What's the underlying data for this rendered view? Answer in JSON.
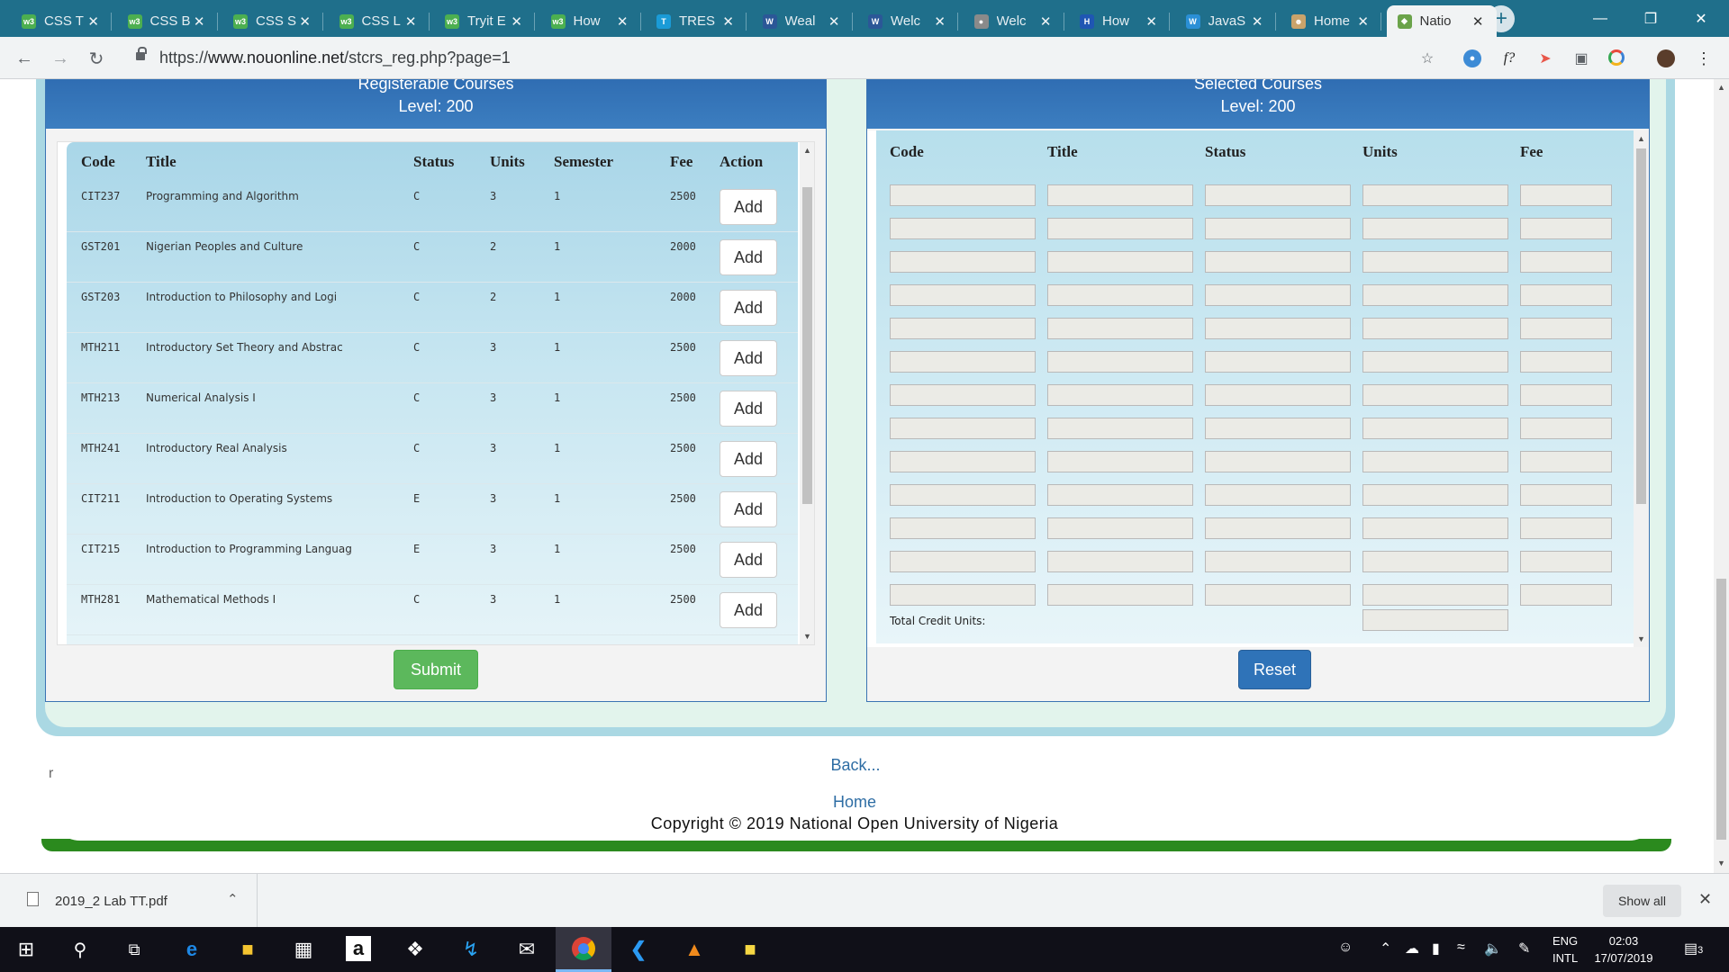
{
  "browser": {
    "tabs": [
      {
        "label": "CSS T",
        "favicon": "w3"
      },
      {
        "label": "CSS B",
        "favicon": "w3"
      },
      {
        "label": "CSS S",
        "favicon": "w3"
      },
      {
        "label": "CSS L",
        "favicon": "w3"
      },
      {
        "label": "Tryit E",
        "favicon": "w3"
      },
      {
        "label": "How",
        "favicon": "w3"
      },
      {
        "label": "TRES",
        "favicon": "T"
      },
      {
        "label": "Weal",
        "favicon": "W"
      },
      {
        "label": "Welc",
        "favicon": "W"
      },
      {
        "label": "Welc",
        "favicon": "globe"
      },
      {
        "label": "How",
        "favicon": "H"
      },
      {
        "label": "JavaS",
        "favicon": "js"
      },
      {
        "label": "Home",
        "favicon": "person"
      },
      {
        "label": "Natio",
        "favicon": "noun",
        "active": true
      }
    ],
    "new_tab": "+",
    "window_controls": {
      "minimize": "—",
      "maximize": "❐",
      "close": "✕"
    },
    "url": {
      "scheme": "https://",
      "host": "www.nouonline.net",
      "path": "/stcrs_reg.php?page=1"
    }
  },
  "left_panel": {
    "title": "Registerable Courses",
    "level": "Level: 200",
    "headers": {
      "code": "Code",
      "title": "Title",
      "status": "Status",
      "units": "Units",
      "semester": "Semester",
      "fee": "Fee",
      "action": "Action"
    },
    "rows": [
      {
        "code": "CIT237",
        "title": "Programming and Algorithm",
        "status": "C",
        "units": "3",
        "semester": "1",
        "fee": "2500",
        "action": "Add"
      },
      {
        "code": "GST201",
        "title": "Nigerian Peoples and Culture",
        "status": "C",
        "units": "2",
        "semester": "1",
        "fee": "2000",
        "action": "Add"
      },
      {
        "code": "GST203",
        "title": "Introduction to Philosophy and Logi",
        "status": "C",
        "units": "2",
        "semester": "1",
        "fee": "2000",
        "action": "Add"
      },
      {
        "code": "MTH211",
        "title": "Introductory Set Theory and Abstrac",
        "status": "C",
        "units": "3",
        "semester": "1",
        "fee": "2500",
        "action": "Add"
      },
      {
        "code": "MTH213",
        "title": "Numerical Analysis I",
        "status": "C",
        "units": "3",
        "semester": "1",
        "fee": "2500",
        "action": "Add"
      },
      {
        "code": "MTH241",
        "title": "Introductory Real Analysis",
        "status": "C",
        "units": "3",
        "semester": "1",
        "fee": "2500",
        "action": "Add"
      },
      {
        "code": "CIT211",
        "title": "Introduction to Operating Systems",
        "status": "E",
        "units": "3",
        "semester": "1",
        "fee": "2500",
        "action": "Add"
      },
      {
        "code": "CIT215",
        "title": "Introduction to Programming Languag",
        "status": "E",
        "units": "3",
        "semester": "1",
        "fee": "2500",
        "action": "Add"
      },
      {
        "code": "MTH281",
        "title": "Mathematical Methods I",
        "status": "C",
        "units": "3",
        "semester": "1",
        "fee": "2500",
        "action": "Add"
      }
    ],
    "submit": "Submit"
  },
  "right_panel": {
    "title": "Selected Courses",
    "level": "Level: 200",
    "headers": {
      "code": "Code",
      "title": "Title",
      "status": "Status",
      "units": "Units",
      "fee": "Fee"
    },
    "empty_rows": 13,
    "total_label": "Total Credit Units:",
    "reset": "Reset"
  },
  "page": {
    "back_link": "Back...",
    "stray_char": "r",
    "footer_home": "Home",
    "copyright": "Copyright © 2019 National Open University of Nigeria"
  },
  "downloads": {
    "file": "2019_2 Lab TT.pdf",
    "show_all": "Show all"
  },
  "taskbar": {
    "lang_line1": "ENG",
    "lang_line2": "INTL",
    "time": "02:03",
    "date": "17/07/2019",
    "notifications": "3"
  },
  "colors": {
    "tab_strip": "#1f6f8b",
    "panel_header": "#2d6ab0",
    "submit": "#5cb85c",
    "reset": "#2f73b8",
    "footer_bar": "#2b8a1e"
  }
}
